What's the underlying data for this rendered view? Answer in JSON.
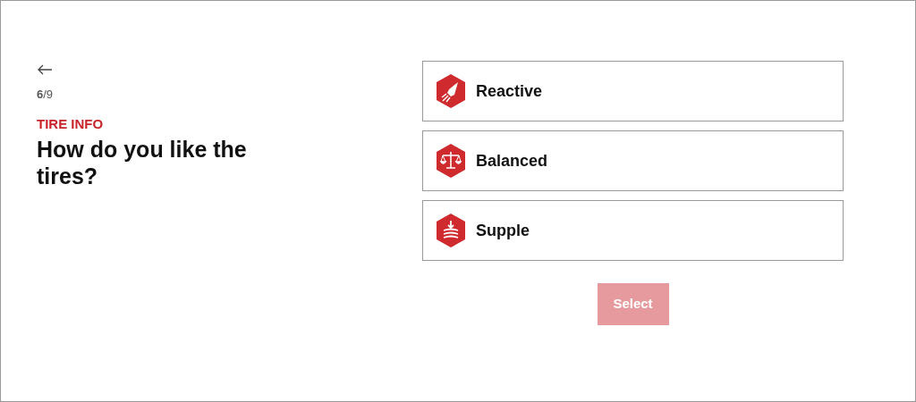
{
  "step": "**6**/9",
  "section": "TIRE INFO",
  "question": "How do you like the tires?",
  "options": [
    {
      "kind": "rocket",
      "label": "Reactive",
      "selected": false
    },
    {
      "kind": "scale",
      "label": "Balanced",
      "selected": false
    },
    {
      "kind": "compress",
      "label": "Supple",
      "selected": false
    }
  ],
  "submit": {
    "label": "Select",
    "disabled": true
  }
}
